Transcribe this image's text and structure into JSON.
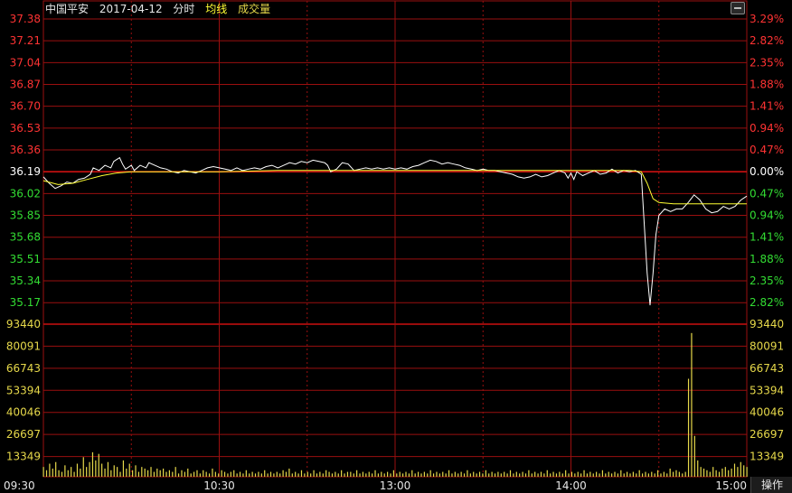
{
  "header": {
    "stock_name": "中国平安",
    "date": "2017-04-12",
    "view_mode": "分时",
    "avg_label": "均线",
    "volume_label": "成交量"
  },
  "buttons": {
    "operate": "操作"
  },
  "colors": {
    "background": "#000000",
    "grid": "#9a0f0f",
    "base_line": "#cc1111",
    "up": "#ff3333",
    "down": "#33dd33",
    "price_line": "#ffffff",
    "avg_line": "#ffff33",
    "volume_bar": "#e6d84a",
    "time_label": "#e6e6e6"
  },
  "chart_data": {
    "type": "line",
    "prev_close": 36.19,
    "price_ticks": [
      "37.38",
      "37.21",
      "37.04",
      "36.87",
      "36.70",
      "36.53",
      "36.36",
      "36.19",
      "36.02",
      "35.85",
      "35.68",
      "35.51",
      "35.34",
      "35.17"
    ],
    "percent_ticks": [
      "3.29%",
      "2.82%",
      "2.35%",
      "1.88%",
      "1.41%",
      "0.94%",
      "0.47%",
      "0.00%",
      "0.47%",
      "0.94%",
      "1.41%",
      "1.88%",
      "2.35%",
      "2.82%"
    ],
    "volume_ticks": [
      "93440",
      "80091",
      "66743",
      "53394",
      "40046",
      "26697",
      "13349"
    ],
    "time_labels": [
      "09:30",
      "10:30",
      "13:00",
      "14:00",
      "15:00"
    ],
    "price_range": [
      35.0,
      37.38
    ],
    "volume_range": [
      0,
      93440
    ],
    "x_range": [
      0,
      240
    ],
    "series": [
      {
        "key": "price",
        "points": [
          [
            0,
            36.15
          ],
          [
            2,
            36.1
          ],
          [
            4,
            36.06
          ],
          [
            6,
            36.08
          ],
          [
            8,
            36.11
          ],
          [
            10,
            36.1
          ],
          [
            12,
            36.13
          ],
          [
            14,
            36.14
          ],
          [
            16,
            36.17
          ],
          [
            17,
            36.22
          ],
          [
            19,
            36.2
          ],
          [
            21,
            36.24
          ],
          [
            23,
            36.22
          ],
          [
            24,
            36.27
          ],
          [
            26,
            36.3
          ],
          [
            27,
            36.25
          ],
          [
            28,
            36.21
          ],
          [
            30,
            36.24
          ],
          [
            31,
            36.2
          ],
          [
            33,
            36.24
          ],
          [
            35,
            36.22
          ],
          [
            36,
            36.26
          ],
          [
            38,
            36.24
          ],
          [
            40,
            36.22
          ],
          [
            42,
            36.21
          ],
          [
            44,
            36.19
          ],
          [
            46,
            36.18
          ],
          [
            48,
            36.2
          ],
          [
            50,
            36.19
          ],
          [
            52,
            36.18
          ],
          [
            54,
            36.2
          ],
          [
            56,
            36.22
          ],
          [
            58,
            36.23
          ],
          [
            60,
            36.22
          ],
          [
            62,
            36.21
          ],
          [
            64,
            36.2
          ],
          [
            66,
            36.22
          ],
          [
            68,
            36.2
          ],
          [
            70,
            36.21
          ],
          [
            72,
            36.22
          ],
          [
            74,
            36.21
          ],
          [
            76,
            36.23
          ],
          [
            78,
            36.24
          ],
          [
            80,
            36.22
          ],
          [
            82,
            36.24
          ],
          [
            84,
            36.26
          ],
          [
            86,
            36.25
          ],
          [
            88,
            36.27
          ],
          [
            90,
            36.26
          ],
          [
            92,
            36.28
          ],
          [
            94,
            36.27
          ],
          [
            96,
            36.26
          ],
          [
            97,
            36.24
          ],
          [
            98,
            36.19
          ],
          [
            100,
            36.21
          ],
          [
            102,
            36.26
          ],
          [
            104,
            36.25
          ],
          [
            106,
            36.2
          ],
          [
            108,
            36.21
          ],
          [
            110,
            36.22
          ],
          [
            112,
            36.21
          ],
          [
            114,
            36.22
          ],
          [
            116,
            36.21
          ],
          [
            118,
            36.22
          ],
          [
            120,
            36.21
          ],
          [
            122,
            36.22
          ],
          [
            124,
            36.21
          ],
          [
            126,
            36.23
          ],
          [
            128,
            36.24
          ],
          [
            130,
            36.26
          ],
          [
            132,
            36.28
          ],
          [
            134,
            36.27
          ],
          [
            136,
            36.25
          ],
          [
            138,
            36.26
          ],
          [
            140,
            36.25
          ],
          [
            142,
            36.24
          ],
          [
            144,
            36.22
          ],
          [
            146,
            36.21
          ],
          [
            148,
            36.2
          ],
          [
            150,
            36.21
          ],
          [
            152,
            36.2
          ],
          [
            154,
            36.2
          ],
          [
            156,
            36.19
          ],
          [
            158,
            36.18
          ],
          [
            160,
            36.17
          ],
          [
            162,
            36.15
          ],
          [
            164,
            36.14
          ],
          [
            166,
            36.15
          ],
          [
            168,
            36.17
          ],
          [
            170,
            36.15
          ],
          [
            172,
            36.16
          ],
          [
            174,
            36.18
          ],
          [
            176,
            36.2
          ],
          [
            178,
            36.18
          ],
          [
            179,
            36.14
          ],
          [
            180,
            36.18
          ],
          [
            181,
            36.13
          ],
          [
            182,
            36.19
          ],
          [
            184,
            36.16
          ],
          [
            186,
            36.18
          ],
          [
            188,
            36.2
          ],
          [
            190,
            36.17
          ],
          [
            192,
            36.18
          ],
          [
            194,
            36.21
          ],
          [
            196,
            36.18
          ],
          [
            198,
            36.2
          ],
          [
            200,
            36.19
          ],
          [
            202,
            36.2
          ],
          [
            204,
            36.17
          ],
          [
            206,
            35.4
          ],
          [
            207,
            35.15
          ],
          [
            208,
            35.4
          ],
          [
            209,
            35.7
          ],
          [
            210,
            35.85
          ],
          [
            212,
            35.9
          ],
          [
            214,
            35.88
          ],
          [
            216,
            35.9
          ],
          [
            218,
            35.9
          ],
          [
            220,
            35.95
          ],
          [
            222,
            36.01
          ],
          [
            224,
            35.97
          ],
          [
            226,
            35.9
          ],
          [
            228,
            35.87
          ],
          [
            230,
            35.88
          ],
          [
            232,
            35.92
          ],
          [
            234,
            35.9
          ],
          [
            236,
            35.92
          ],
          [
            238,
            35.97
          ],
          [
            240,
            36.0
          ]
        ]
      },
      {
        "key": "avg",
        "points": [
          [
            0,
            36.12
          ],
          [
            5,
            36.09
          ],
          [
            10,
            36.1
          ],
          [
            15,
            36.13
          ],
          [
            20,
            36.16
          ],
          [
            25,
            36.18
          ],
          [
            30,
            36.19
          ],
          [
            40,
            36.19
          ],
          [
            60,
            36.19
          ],
          [
            80,
            36.2
          ],
          [
            100,
            36.2
          ],
          [
            120,
            36.2
          ],
          [
            140,
            36.2
          ],
          [
            160,
            36.2
          ],
          [
            180,
            36.2
          ],
          [
            200,
            36.2
          ],
          [
            204,
            36.19
          ],
          [
            206,
            36.1
          ],
          [
            208,
            35.98
          ],
          [
            210,
            35.95
          ],
          [
            215,
            35.94
          ],
          [
            220,
            35.94
          ],
          [
            240,
            35.94
          ]
        ]
      }
    ],
    "volume": [
      6000,
      4000,
      8000,
      5000,
      9000,
      4000,
      3000,
      7000,
      4000,
      6000,
      3000,
      8000,
      5000,
      12000,
      6000,
      9000,
      15000,
      10000,
      14000,
      8000,
      5000,
      9000,
      4000,
      7000,
      6000,
      3000,
      10000,
      5000,
      8000,
      4000,
      7000,
      3000,
      6000,
      5000,
      4000,
      6000,
      3000,
      5000,
      4000,
      5000,
      3000,
      4000,
      3000,
      6000,
      2000,
      4000,
      3000,
      5000,
      2000,
      3000,
      4000,
      2000,
      4000,
      3000,
      2000,
      5000,
      3000,
      2000,
      4000,
      3000,
      2000,
      3000,
      4000,
      2000,
      3000,
      2000,
      4000,
      2000,
      3000,
      2000,
      3000,
      2000,
      4000,
      2000,
      3000,
      2000,
      3000,
      2000,
      4000,
      3000,
      5000,
      2000,
      3000,
      2000,
      4000,
      2000,
      3000,
      2000,
      4000,
      2000,
      3000,
      2000,
      4000,
      3000,
      2000,
      3000,
      2000,
      4000,
      2000,
      3000,
      3000,
      2000,
      4000,
      2000,
      3000,
      2000,
      3000,
      2000,
      4000,
      2000,
      3000,
      2000,
      3000,
      2000,
      4000,
      2000,
      3000,
      2000,
      3000,
      2000,
      4000,
      2000,
      3000,
      2000,
      3000,
      2000,
      4000,
      2000,
      3000,
      2000,
      3000,
      2000,
      4000,
      2000,
      3000,
      2000,
      3000,
      2000,
      4000,
      2000,
      3000,
      2000,
      3000,
      2000,
      4000,
      2000,
      3000,
      2000,
      3000,
      2000,
      3000,
      2000,
      4000,
      2000,
      3000,
      2000,
      3000,
      2000,
      4000,
      2000,
      3000,
      2000,
      3000,
      2000,
      4000,
      2000,
      3000,
      2000,
      3000,
      2000,
      4000,
      2000,
      3000,
      2000,
      3000,
      2000,
      4000,
      2000,
      3000,
      2000,
      3000,
      2000,
      4000,
      2000,
      3000,
      2000,
      3000,
      2000,
      4000,
      2000,
      3000,
      2000,
      3000,
      2000,
      4000,
      2000,
      3000,
      2000,
      3000,
      2000,
      4000,
      2000,
      3000,
      2000,
      5000,
      3000,
      4000,
      3000,
      2000,
      3000,
      60000,
      88000,
      25000,
      10000,
      6000,
      5000,
      4000,
      3000,
      6000,
      4000,
      3000,
      5000,
      6000,
      4000,
      5000,
      8000,
      6000,
      9000,
      7000,
      6000
    ],
    "grid": true
  }
}
